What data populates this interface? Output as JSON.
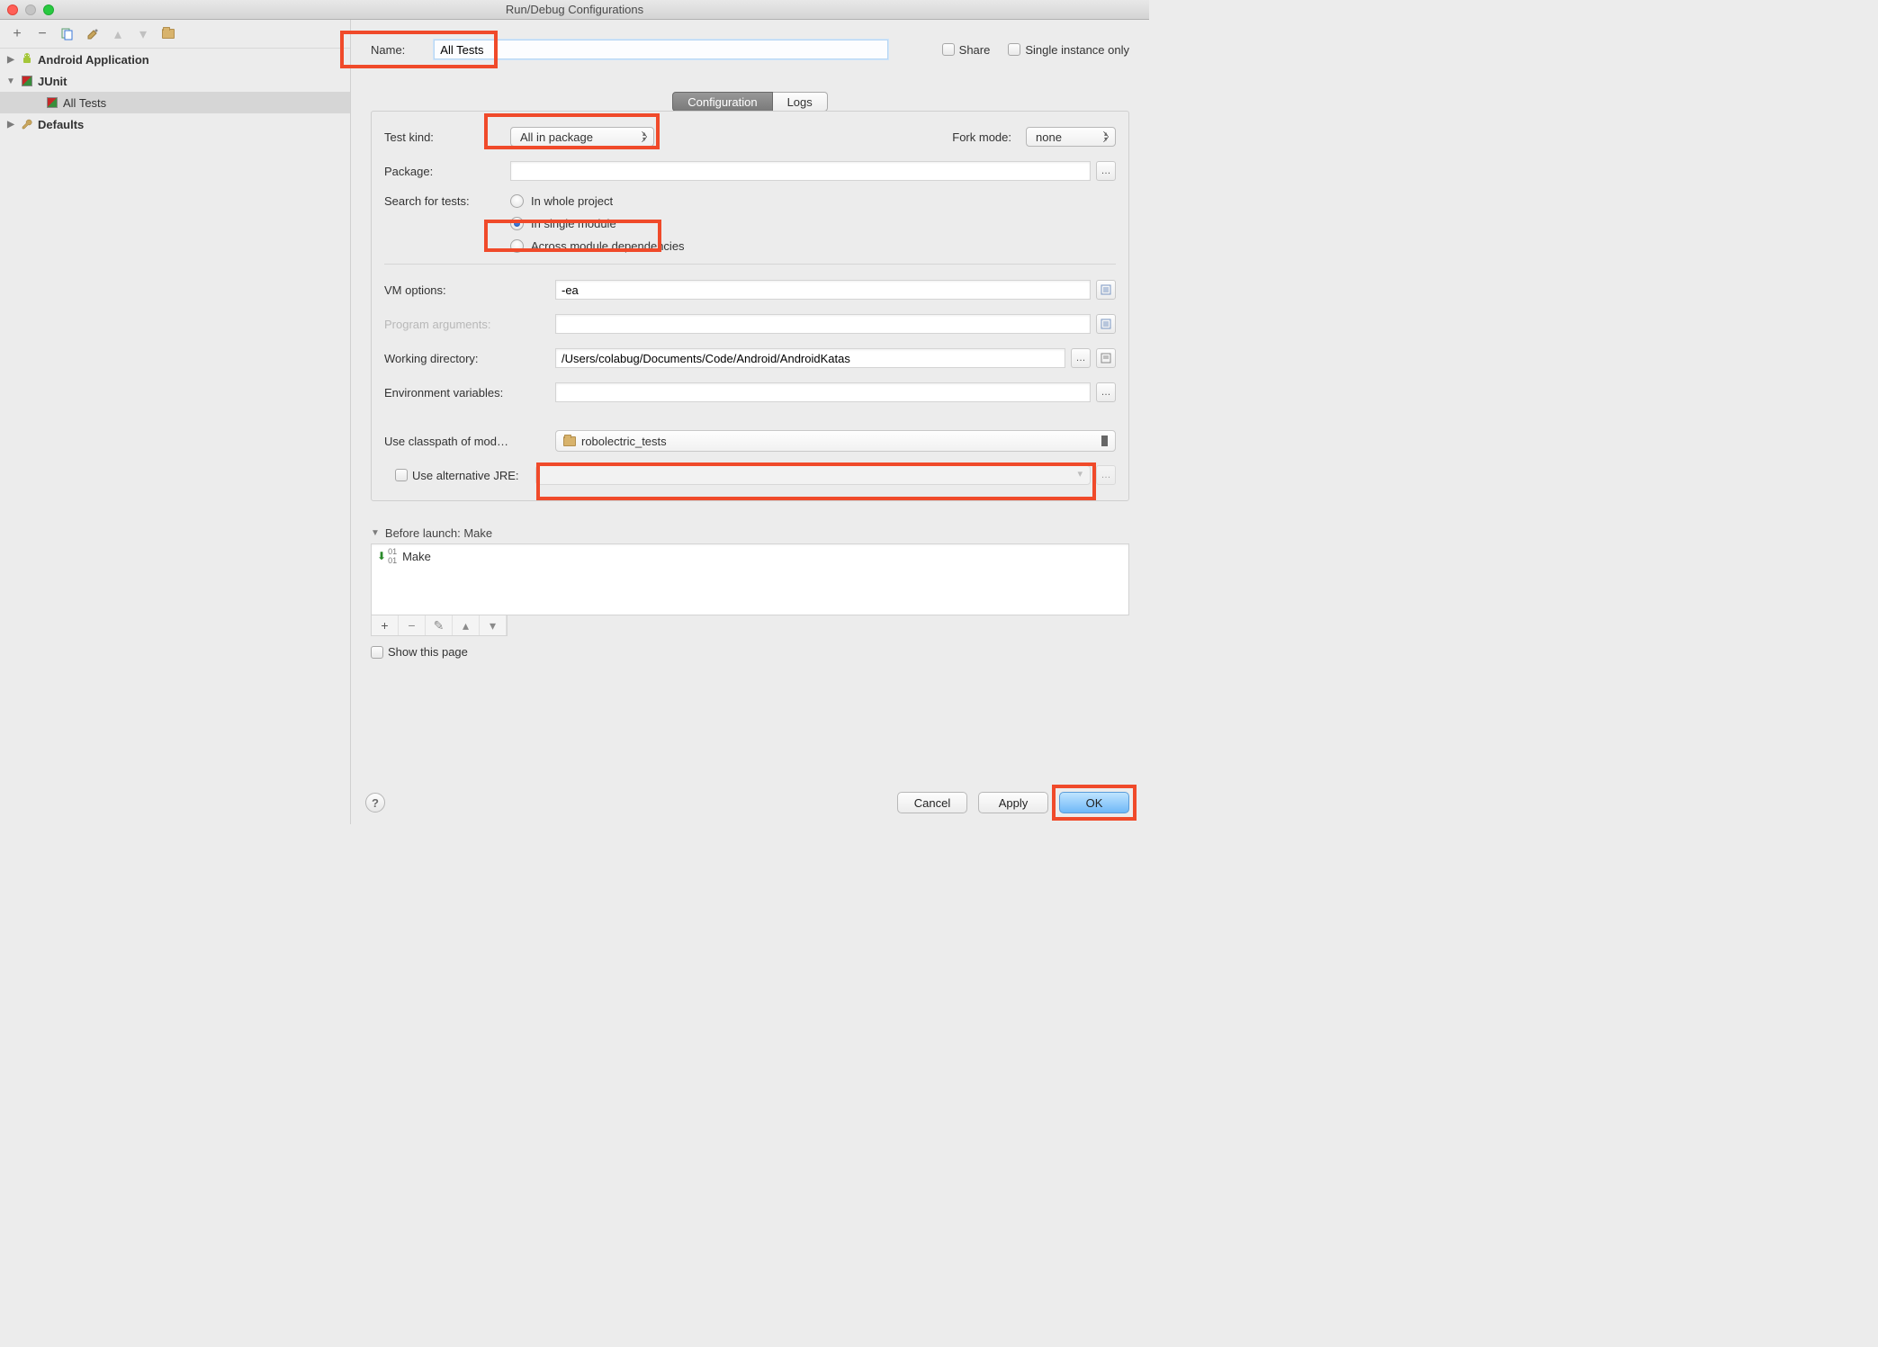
{
  "window": {
    "title": "Run/Debug Configurations"
  },
  "tree": {
    "android": "Android Application",
    "junit": "JUnit",
    "all_tests": "All Tests",
    "defaults": "Defaults"
  },
  "header": {
    "name_label": "Name:",
    "name_value": "All Tests",
    "share": "Share",
    "single_instance": "Single instance only"
  },
  "tabs": {
    "configuration": "Configuration",
    "logs": "Logs"
  },
  "config": {
    "test_kind": {
      "label": "Test kind:",
      "value": "All in package"
    },
    "fork_mode": {
      "label": "Fork mode:",
      "value": "none"
    },
    "package": {
      "label": "Package:",
      "value": ""
    },
    "search": {
      "label": "Search for tests:",
      "opt_whole": "In whole project",
      "opt_single": "In single module",
      "opt_across": "Across module dependencies"
    },
    "vm_options": {
      "label": "VM options:",
      "value": "-ea"
    },
    "program_args": {
      "label": "Program arguments:",
      "value": ""
    },
    "working_dir": {
      "label": "Working directory:",
      "value": "/Users/colabug/Documents/Code/Android/AndroidKatas"
    },
    "env_vars": {
      "label": "Environment variables:",
      "value": ""
    },
    "classpath": {
      "label": "Use classpath of mod…",
      "value": "robolectric_tests"
    },
    "alt_jre": {
      "label": "Use alternative JRE:"
    }
  },
  "before_launch": {
    "header": "Before launch: Make",
    "make": "Make",
    "show_page": "Show this page"
  },
  "footer": {
    "cancel": "Cancel",
    "apply": "Apply",
    "ok": "OK"
  }
}
